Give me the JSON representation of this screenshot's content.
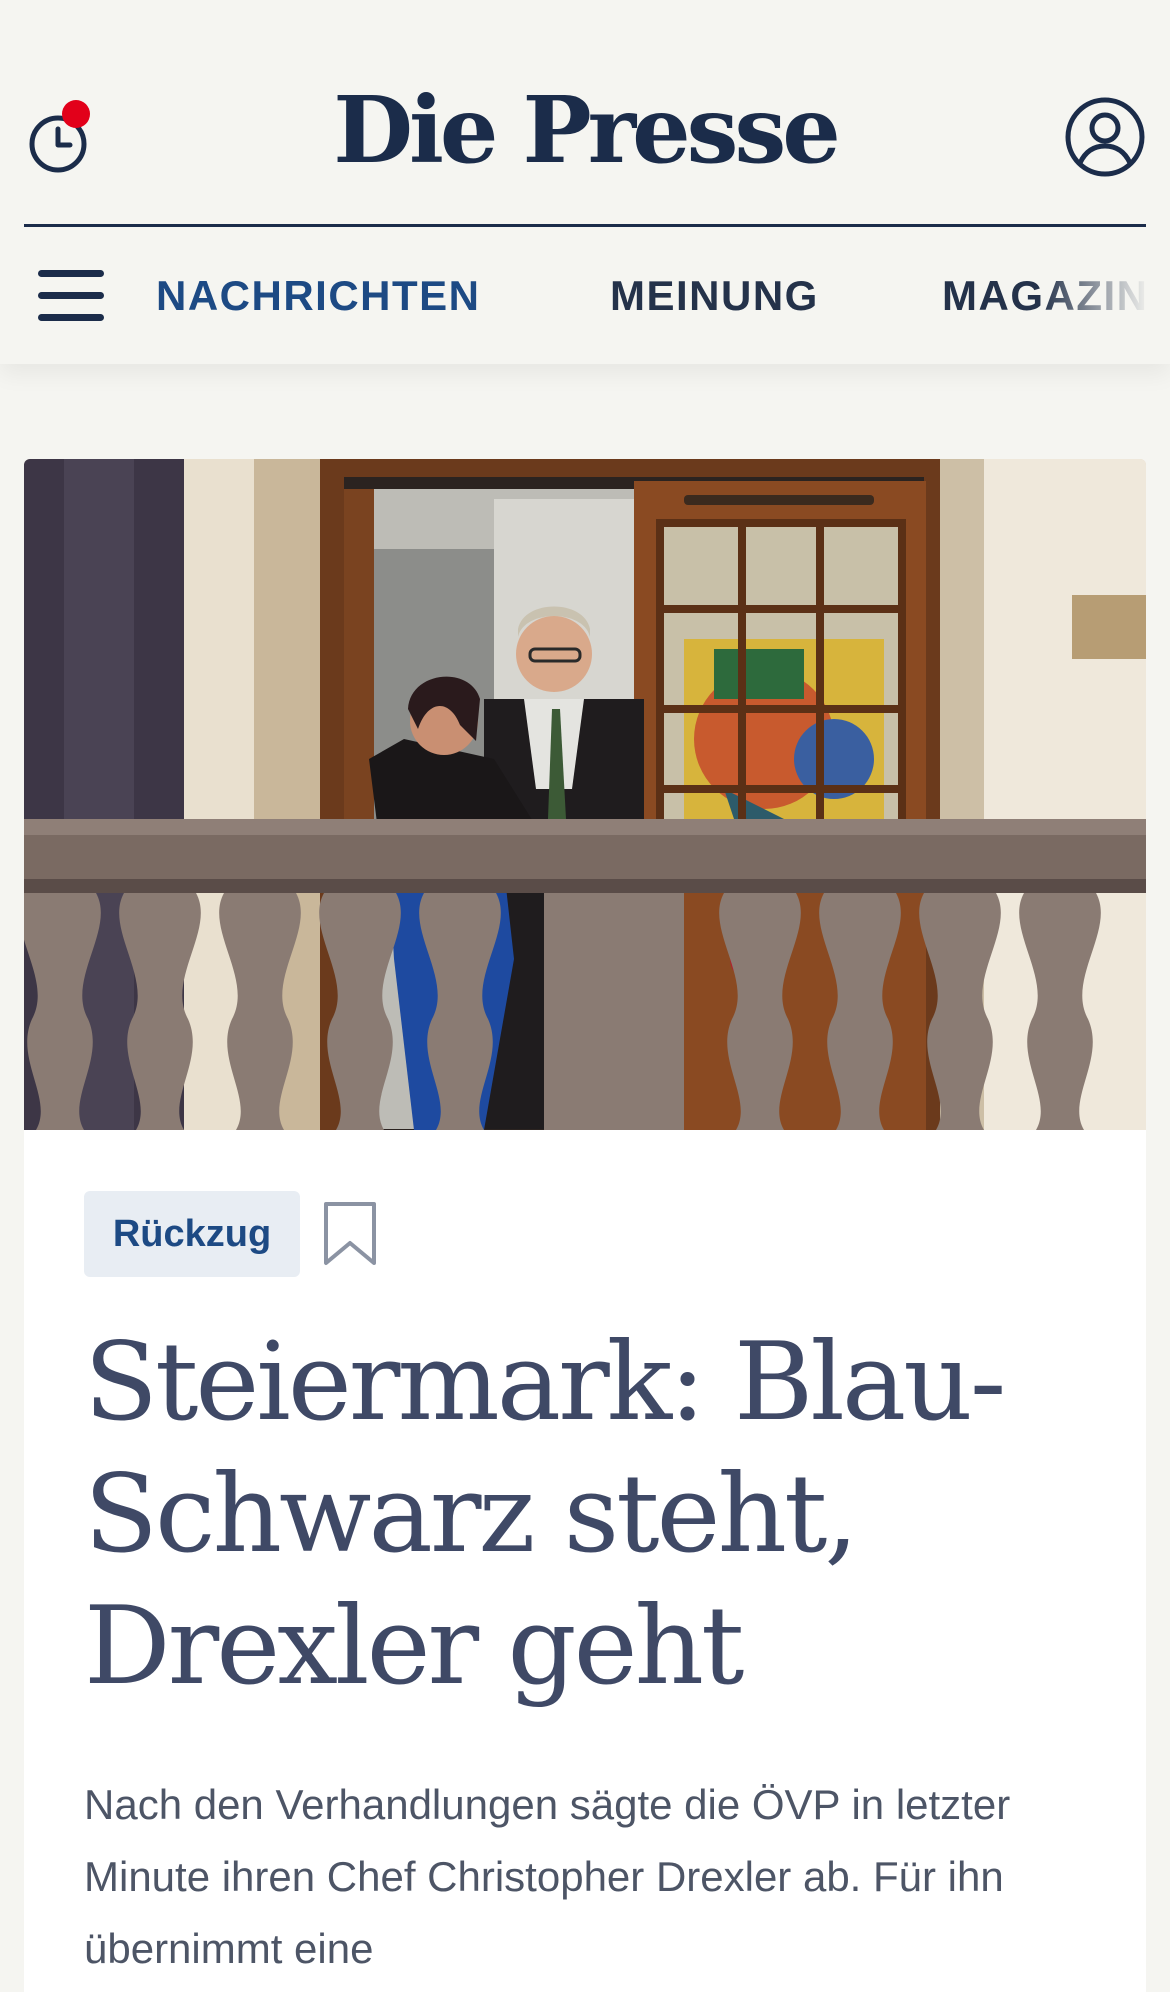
{
  "header": {
    "logo": "Die Presse"
  },
  "nav": {
    "items": [
      {
        "label": "NACHRICHTEN",
        "active": true
      },
      {
        "label": "MEINUNG",
        "active": false
      },
      {
        "label": "MAGAZIN",
        "active": false
      }
    ]
  },
  "article": {
    "tag": "Rückzug",
    "headline": "Steiermark: Blau-Schwarz steht, Drexler geht",
    "lead": "Nach den Verhandlungen sägte die ÖVP in letzter Minute ihren Chef Christopher Drexler ab. Für ihn übernimmt eine"
  },
  "icons": {
    "history": "clock-notification-icon",
    "account": "user-icon",
    "menu": "hamburger-menu-icon",
    "bookmark": "bookmark-icon"
  },
  "colors": {
    "brand_navy": "#1b2c4a",
    "nav_active": "#1d4a84",
    "notification_dot": "#e2001a",
    "tag_background": "#e8edf3",
    "headline": "#3f4966",
    "page_background": "#f5f5f1"
  }
}
